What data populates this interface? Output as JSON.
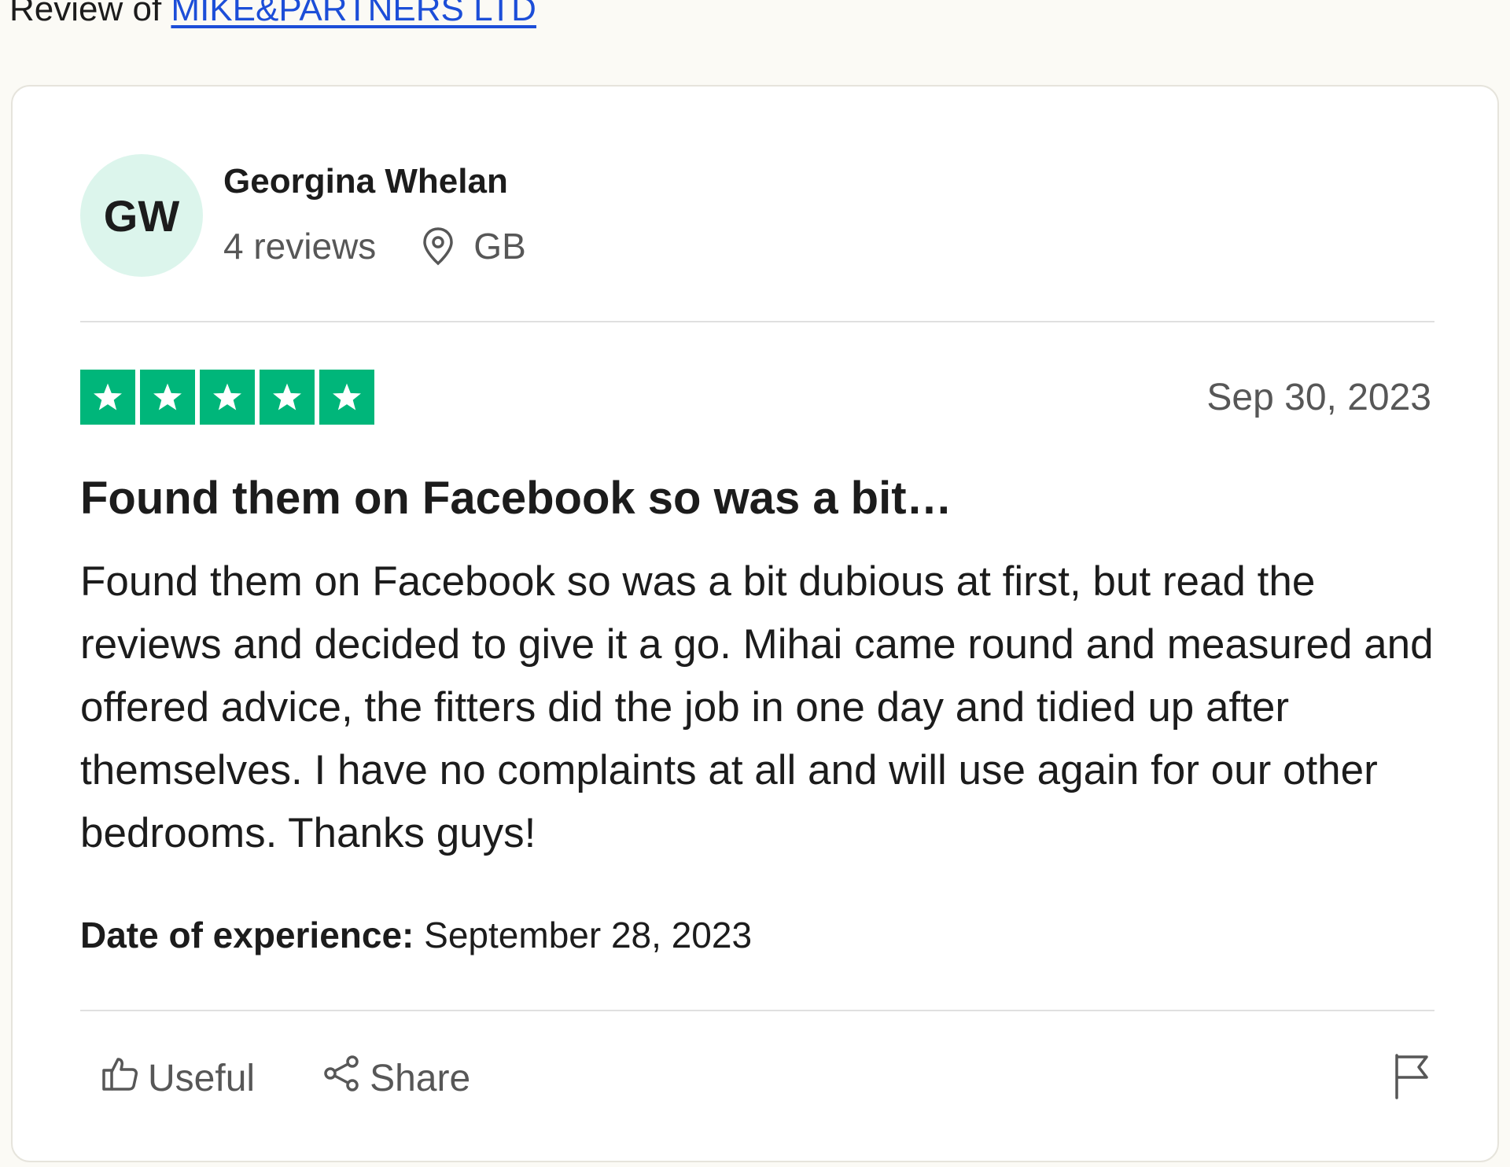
{
  "header": {
    "prefix": "Review of",
    "company_link": "MIKE&PARTNERS LTD"
  },
  "consumer": {
    "initials": "GW",
    "name": "Georgina Whelan",
    "reviews_count": "4 reviews",
    "country": "GB",
    "avatar_color": "#dcf5ec"
  },
  "review": {
    "rating": 5,
    "rating_max": 5,
    "star_color": "#00b67a",
    "date": "Sep 30, 2023",
    "title": "Found them on Facebook so was a bit…",
    "body": "Found them on Facebook so was a bit dubious at first, but read the reviews and decided to give it a go. Mihai came round and measured and offered advice, the fitters did the job in one day and tidied up after themselves. I have no complaints at all and will use again for our other bedrooms. Thanks guys!",
    "experience_label": "Date of experience:",
    "experience_date": "September 28, 2023"
  },
  "actions": {
    "useful_label": "Useful",
    "share_label": "Share",
    "useful_icon": "thumbs-up-icon",
    "share_icon": "share-icon",
    "flag_icon": "flag-icon"
  }
}
